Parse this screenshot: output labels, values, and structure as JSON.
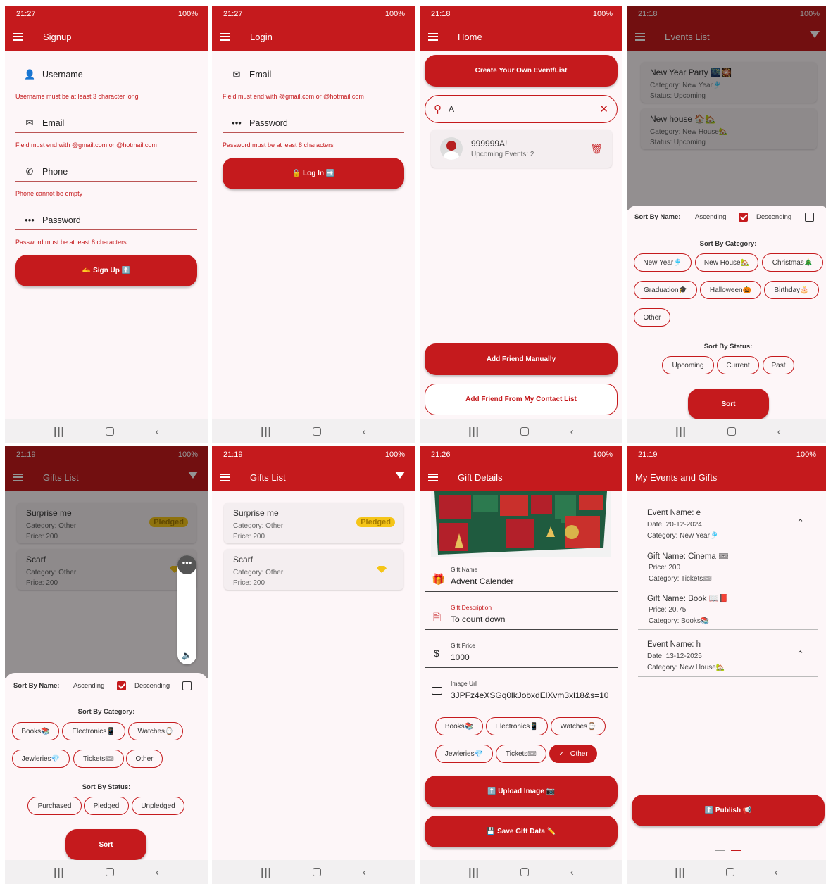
{
  "status_bars": [
    {
      "time": "21:27",
      "right": "100%"
    },
    {
      "time": "21:27",
      "right": "100%"
    },
    {
      "time": "21:18",
      "right": "100%"
    },
    {
      "time": "21:18",
      "right": "100%"
    },
    {
      "time": "21:19",
      "right": "100%"
    },
    {
      "time": "21:19",
      "right": "100%"
    },
    {
      "time": "21:26",
      "right": "100%"
    },
    {
      "time": "21:19",
      "right": "100%"
    }
  ],
  "signup": {
    "title": "Signup",
    "fields": [
      {
        "label": "Username",
        "error": "Username must be at least 3 character long"
      },
      {
        "label": "Email",
        "error": "Field must end with @gmail.com or @hotmail.com"
      },
      {
        "label": "Phone",
        "error": "Phone cannot be empty"
      },
      {
        "label": "Password",
        "error": "Password must be at least 8 characters"
      }
    ],
    "button": "🫴 Sign Up ⬆️"
  },
  "login": {
    "title": "Login",
    "fields": [
      {
        "label": "Email",
        "error": "Field must end with @gmail.com or @hotmail.com"
      },
      {
        "label": "Password",
        "error": "Password must be at least 8 characters"
      }
    ],
    "button": "🔓 Log In ➡️"
  },
  "home": {
    "title": "Home",
    "create_button": "Create Your Own Event/List",
    "search_value": "A",
    "friend": {
      "name": "999999A!",
      "sub": "Upcoming Events: 2"
    },
    "add_manual": "Add Friend Manually",
    "add_contact": "Add Friend From My Contact List"
  },
  "events_list": {
    "title": "Events List",
    "events": [
      {
        "name": "New Year Party 🌃🎇",
        "category": "Category: New Year🎐",
        "status": "Status: Upcoming"
      },
      {
        "name": "New house 🏠🏡",
        "category": "Category: New House🏡",
        "status": "Status: Upcoming"
      }
    ],
    "sort_by_name": "Sort By Name:",
    "ascending": "Ascending",
    "descending": "Descending",
    "sort_by_category": "Sort By Category:",
    "categories": [
      "New Year🎐",
      "New House🏡",
      "Christmas🎄",
      "Graduation🎓",
      "Halloween🎃",
      "Birthday🎂",
      "Other"
    ],
    "sort_by_status": "Sort By Status:",
    "statuses": [
      "Upcoming",
      "Current",
      "Past"
    ],
    "sort": "Sort"
  },
  "gifts_dim": {
    "title": "Gifts List",
    "gifts": [
      {
        "name": "Surprise me",
        "category": "Category: Other",
        "price": "Price: 200",
        "badge": "Pledged"
      },
      {
        "name": "Scarf",
        "category": "Category: Other",
        "price": "Price: 200"
      }
    ],
    "sort_by_name": "Sort By Name:",
    "ascending": "Ascending",
    "descending": "Descending",
    "sort_by_category": "Sort By Category:",
    "categories": [
      "Books📚",
      "Electronics📱",
      "Watches⌚",
      "Jewleries💎",
      "Tickets🎟",
      "Other"
    ],
    "sort_by_status": "Sort By Status:",
    "statuses": [
      "Purchased",
      "Pledged",
      "Unpledged"
    ],
    "sort": "Sort"
  },
  "gifts": {
    "title": "Gifts List",
    "gifts": [
      {
        "name": "Surprise me",
        "category": "Category: Other",
        "price": "Price: 200",
        "badge": "Pledged"
      },
      {
        "name": "Scarf",
        "category": "Category: Other",
        "price": "Price: 200"
      }
    ]
  },
  "gift_details": {
    "title": "Gift Details",
    "fields": [
      {
        "label": "Gift Name",
        "value": "Advent Calender"
      },
      {
        "label": "Gift Description",
        "value": "To count down"
      },
      {
        "label": "Gift Price",
        "value": "1000"
      },
      {
        "label": "Image Url",
        "value": "3JPFz4eXSGq0lkJobxdElXvm3xl18&s=10"
      }
    ],
    "categories": [
      "Books📚",
      "Electronics📱",
      "Watches⌚",
      "Jewleries💎",
      "Tickets🎟",
      "Other"
    ],
    "upload": "⬆️ Upload Image 📷",
    "save": "💾 Save Gift Data ✏️"
  },
  "my_events": {
    "title": "My Events and Gifts",
    "events": [
      {
        "name": "Event Name: e",
        "date": "Date: 20-12-2024",
        "category": "Category: New Year🎐",
        "gifts": [
          {
            "name": "Gift Name: Cinema 🎟",
            "price": "Price: 200",
            "category": "Category: Tickets🎟"
          },
          {
            "name": "Gift Name: Book 📖📕",
            "price": "Price: 20.75",
            "category": "Category: Books📚"
          }
        ]
      },
      {
        "name": "Event Name: h",
        "date": "Date: 13-12-2025",
        "category": "Category: New House🏡",
        "gifts": []
      }
    ],
    "publish": "⬆️ Publish 📢"
  },
  "colors": {
    "primary": "#c51a1d",
    "background": "#fdf6f8",
    "badge": "#f5c518"
  }
}
